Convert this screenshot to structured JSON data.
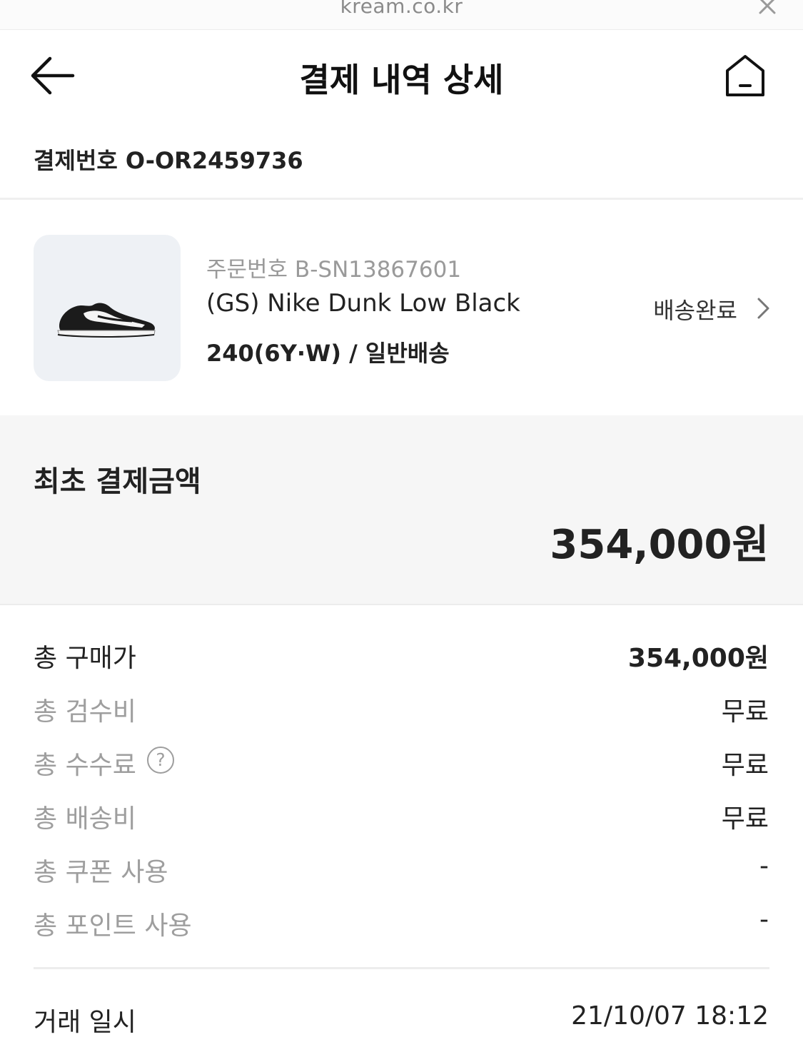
{
  "browser": {
    "url": "kream.co.kr",
    "close_icon": "close-icon"
  },
  "header": {
    "title": "결제 내역 상세",
    "back_icon": "arrow-left-icon",
    "home_icon": "home-icon"
  },
  "payment_number": "결제번호 O-OR2459736",
  "product": {
    "order_number": "주문번호 B-SN13867601",
    "name": "(GS) Nike Dunk Low Black",
    "option": "240(6Y·W) / 일반배송",
    "status": "배송완료",
    "image": "sneaker-image",
    "chevron_icon": "chevron-right-icon"
  },
  "summary": {
    "label": "최초 결제금액",
    "amount": "354,000원"
  },
  "breakdown": [
    {
      "label": "총 구매가",
      "value": "354,000원"
    },
    {
      "label": "총 검수비",
      "value": "무료"
    },
    {
      "label": "총 수수료",
      "value": "무료",
      "help_icon": "help-icon",
      "help_glyph": "?"
    },
    {
      "label": "총 배송비",
      "value": "무료"
    },
    {
      "label": "총 쿠폰 사용",
      "value": "-"
    },
    {
      "label": "총 포인트 사용",
      "value": "-"
    }
  ],
  "transaction": {
    "label": "거래 일시",
    "value": "21/10/07 18:12"
  }
}
